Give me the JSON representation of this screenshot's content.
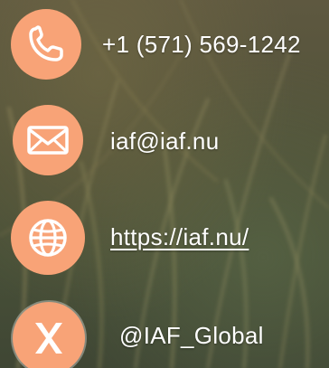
{
  "contacts": {
    "phone": {
      "icon": "phone-icon",
      "text": "+1 (571) 569-1242"
    },
    "email": {
      "icon": "envelope-icon",
      "text": "iaf@iaf.nu"
    },
    "website": {
      "icon": "globe-icon",
      "text": "https://iaf.nu/"
    },
    "social": {
      "icon": "x-logo-icon",
      "text": "@IAF_Global"
    }
  },
  "colors": {
    "accent": "#f8a377",
    "icon_stroke": "#ffffff",
    "text": "#ffffff"
  }
}
